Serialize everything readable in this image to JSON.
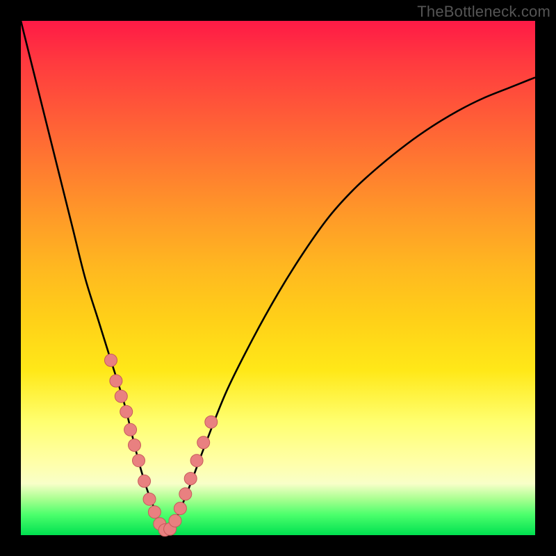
{
  "watermark": "TheBottleneck.com",
  "colors": {
    "background": "#000000",
    "gradient_top": "#ff1a46",
    "gradient_mid": "#ffd018",
    "gradient_bottom": "#00e050",
    "curve": "#000000",
    "marker_fill": "#e98080",
    "marker_stroke": "#c65a5a",
    "watermark": "#555555"
  },
  "chart_data": {
    "type": "line",
    "title": "",
    "xlabel": "",
    "ylabel": "",
    "xlim": [
      0,
      100
    ],
    "ylim": [
      0,
      100
    ],
    "grid": false,
    "legend": false,
    "series": [
      {
        "name": "bottleneck-curve",
        "x": [
          0,
          2.5,
          5,
          7.5,
          10,
          12.5,
          15,
          17.5,
          20,
          21.5,
          23,
          24.5,
          26,
          27,
          28,
          29.5,
          31,
          33,
          36,
          40,
          45,
          50,
          55,
          60,
          65,
          70,
          75,
          80,
          85,
          90,
          95,
          100
        ],
        "values": [
          100,
          90,
          80,
          70,
          60,
          50,
          42,
          34,
          26,
          20,
          14,
          9,
          5,
          2,
          1,
          2,
          5,
          10,
          18,
          28,
          38,
          47,
          55,
          62,
          67.5,
          72,
          76,
          79.5,
          82.5,
          85,
          87,
          89
        ]
      }
    ],
    "markers": {
      "name": "highlight-points",
      "x": [
        17.5,
        18.5,
        19.5,
        20.5,
        21.3,
        22.1,
        22.9,
        24.0,
        25.0,
        26.0,
        27.0,
        28.0,
        29.0,
        30.0,
        31.0,
        32.0,
        33.0,
        34.2,
        35.5,
        37.0
      ],
      "values": [
        34,
        30,
        27,
        24,
        20.5,
        17.5,
        14.5,
        10.5,
        7,
        4.5,
        2.2,
        1,
        1.2,
        2.8,
        5.2,
        8,
        11,
        14.5,
        18,
        22
      ]
    }
  }
}
